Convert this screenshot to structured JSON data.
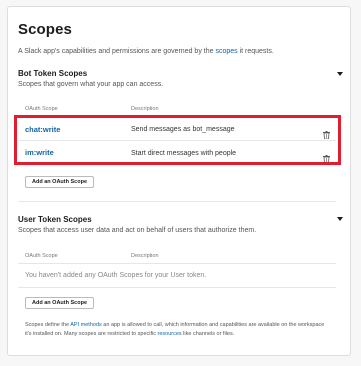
{
  "title": "Scopes",
  "description": {
    "prefix": "A Slack app's capabilities and permissions are governed by the ",
    "link": "scopes",
    "suffix": " it requests."
  },
  "bot_section": {
    "title": "Bot Token Scopes",
    "subtitle": "Scopes that govern what your app can access.",
    "col_scope": "OAuth Scope",
    "col_description": "Description",
    "scopes": [
      {
        "name": "chat:write",
        "description": "Send messages as bot_message"
      },
      {
        "name": "im:write",
        "description": "Start direct messages with people"
      }
    ],
    "add_button": "Add an OAuth Scope"
  },
  "user_section": {
    "title": "User Token Scopes",
    "subtitle": "Scopes that access user data and act on behalf of users that authorize them.",
    "col_scope": "OAuth Scope",
    "col_description": "Description",
    "empty_text": "You haven't added any OAuth Scopes for your User token.",
    "add_button": "Add an OAuth Scope"
  },
  "footer": {
    "part1": "Scopes define the ",
    "link1": "API methods",
    "part2": " an app is allowed to call, which information and capabilities are available on the workspace it's installed on. Many scopes are restricted to specific ",
    "link2": "resources",
    "part3": " like channels or files."
  },
  "colors": {
    "link": "#1264a3",
    "highlight": "#e01e2f"
  },
  "icons": [
    "chevron-down-icon",
    "trash-icon"
  ]
}
